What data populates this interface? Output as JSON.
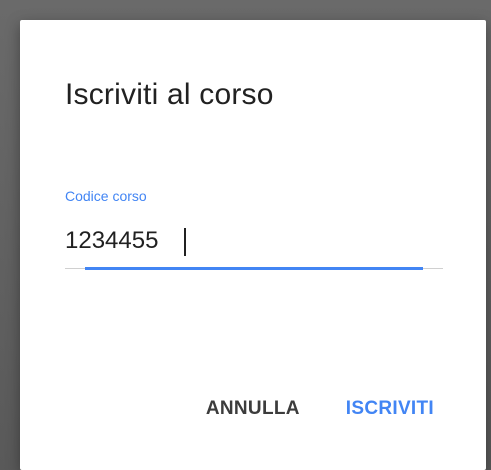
{
  "dialog": {
    "title": "Iscriviti al corso",
    "field": {
      "label": "Codice corso",
      "value": "1234455"
    },
    "actions": {
      "cancel_label": "ANNULLA",
      "confirm_label": "ISCRIVITI"
    }
  },
  "colors": {
    "accent": "#4285f4",
    "text": "#212121",
    "backdrop": "#5f5f5f"
  }
}
